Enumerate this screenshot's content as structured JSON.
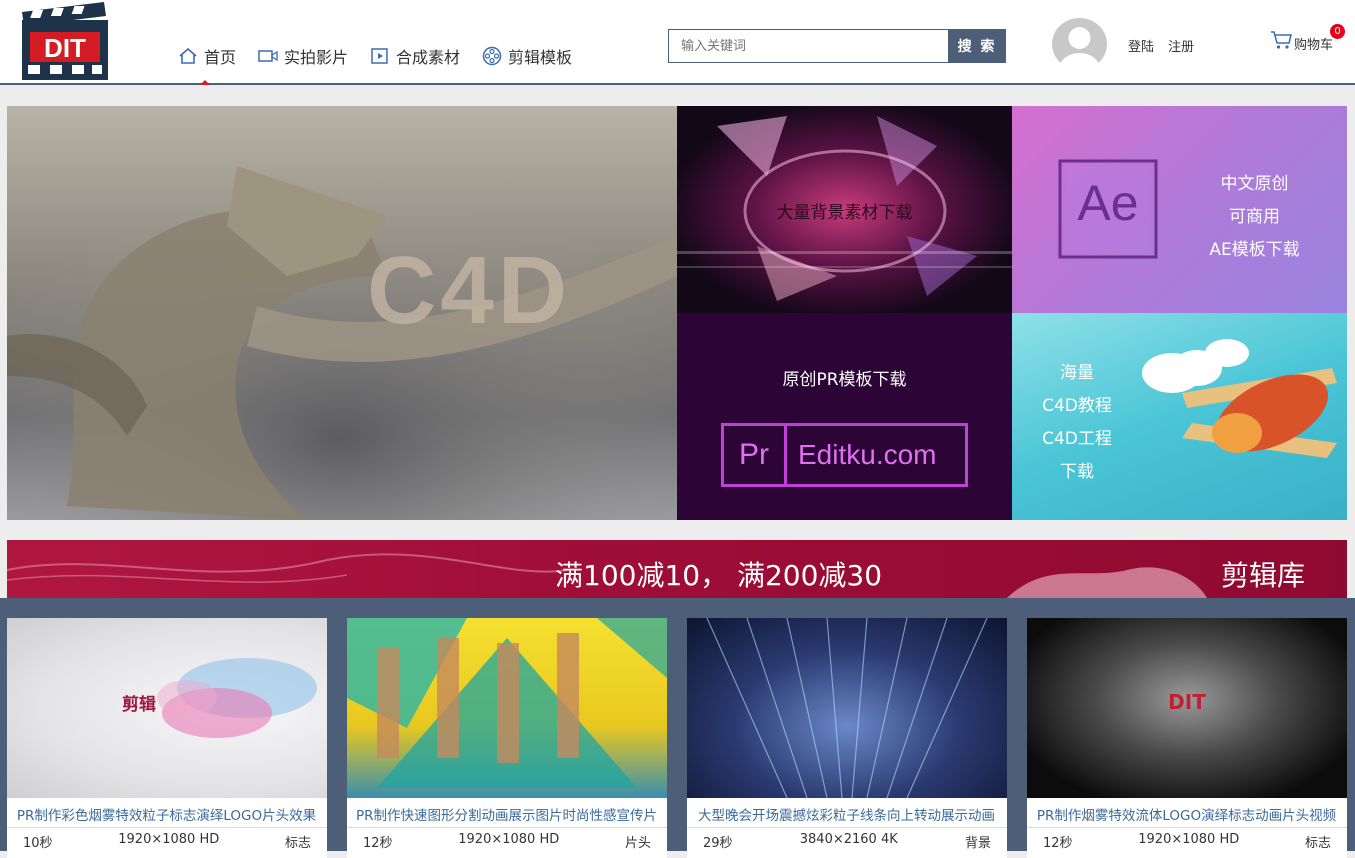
{
  "header": {
    "logo_text": "DIT",
    "nav": [
      {
        "label": "首页",
        "icon": "home-icon"
      },
      {
        "label": "实拍影片",
        "icon": "video-icon"
      },
      {
        "label": "合成素材",
        "icon": "play-icon"
      },
      {
        "label": "剪辑模板",
        "icon": "film-reel-icon"
      }
    ],
    "search": {
      "placeholder": "输入关键词",
      "button": "搜 索"
    },
    "login": "登陆",
    "register": "注册",
    "cart": {
      "label": "购物车",
      "count": "0"
    }
  },
  "banners": {
    "main_text": "C4D",
    "pr_top_text": "大量背景素材下载",
    "ae": {
      "logo": "Ae",
      "lines": [
        "中文原创",
        "可商用",
        "AE模板下载"
      ]
    },
    "pr": {
      "title": "原创PR模板下载",
      "logo": "Pr",
      "site": "Editku.com"
    },
    "c4d": {
      "lines": [
        "海量",
        "C4D教程",
        "C4D工程",
        "下载"
      ]
    }
  },
  "promo": {
    "text": "满100减10， 满200减30",
    "brand": "剪辑库"
  },
  "products": [
    {
      "title": "PR制作彩色烟雾特效粒子标志演绎LOGO片头效果",
      "duration": "10秒",
      "resolution": "1920×1080 HD",
      "category": "标志",
      "thumb_text": "剪辑"
    },
    {
      "title": "PR制作快速图形分割动画展示图片时尚性感宣传片",
      "duration": "12秒",
      "resolution": "1920×1080 HD",
      "category": "片头",
      "thumb_text": ""
    },
    {
      "title": "大型晚会开场震撼炫彩粒子线条向上转动展示动画",
      "duration": "29秒",
      "resolution": "3840×2160 4K",
      "category": "背景",
      "thumb_text": ""
    },
    {
      "title": "PR制作烟雾特效流体LOGO演绎标志动画片头视频",
      "duration": "12秒",
      "resolution": "1920×1080 HD",
      "category": "标志",
      "thumb_text": "DIT"
    }
  ]
}
